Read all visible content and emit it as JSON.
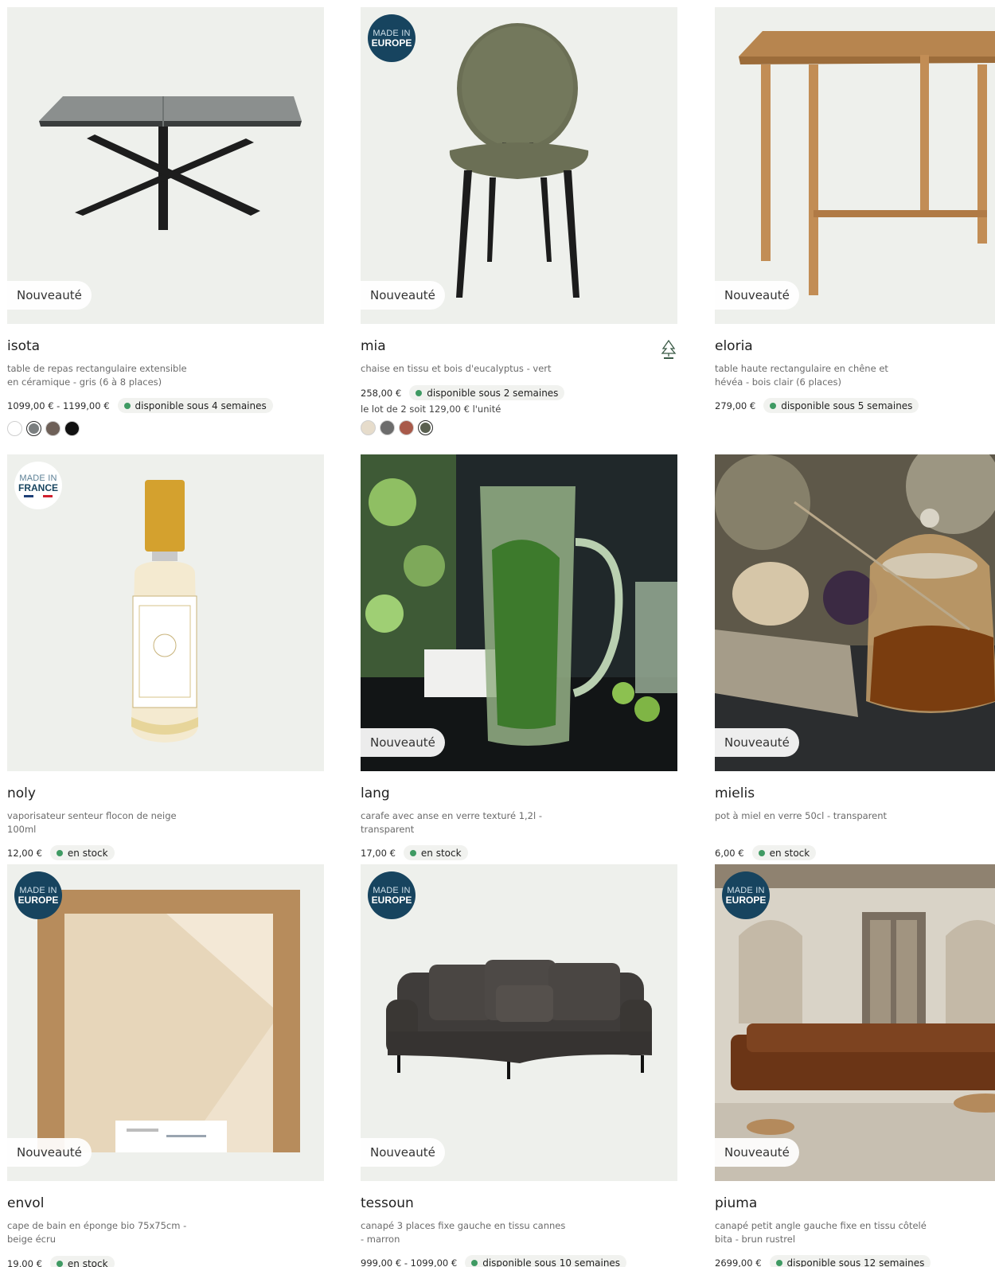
{
  "products": [
    {
      "name": "isota",
      "desc": "table de repas rectangulaire extensible en céramique - gris (6 à 8 places)",
      "price": "1099,00 € - 1199,00 €",
      "stock": "disponible sous 4 semaines",
      "badge": "Nouveauté",
      "swatches": [
        "#ffffff",
        "#7b7f80",
        "#6e6058",
        "#111111"
      ]
    },
    {
      "name": "mia",
      "desc": "chaise en tissu et bois d'eucalyptus - vert",
      "price": "258,00 €",
      "stock": "disponible sous 2 semaines",
      "lot": "le lot de 2 soit 129,00 € l'unité",
      "badge": "Nouveauté",
      "origin_top": "MADE IN",
      "origin_bottom": "EUROPE",
      "swatches": [
        "#e6dccb",
        "#6c6c6c",
        "#a85a4a",
        "#5a6050"
      ]
    },
    {
      "name": "eloria",
      "desc": "table haute rectangulaire en chêne et hévéa - bois clair (6 places)",
      "price": "279,00 €",
      "stock": "disponible sous 5 semaines",
      "badge": "Nouveauté"
    },
    {
      "name": "noly",
      "desc": "vaporisateur senteur flocon de neige 100ml",
      "price": "12,00 €",
      "stock": "en stock",
      "origin_top": "MADE IN",
      "origin_bottom": "FRANCE"
    },
    {
      "name": "lang",
      "desc": "carafe avec anse en verre texturé 1,2l - transparent",
      "price": "17,00 €",
      "stock": "en stock",
      "badge": "Nouveauté"
    },
    {
      "name": "mielis",
      "desc": "pot à miel en verre 50cl - transparent",
      "price": "6,00 €",
      "stock": "en stock",
      "badge": "Nouveauté"
    },
    {
      "name": "envol",
      "desc": "cape de bain en éponge bio 75x75cm - beige écru",
      "price": "19,00 €",
      "stock": "en stock",
      "badge": "Nouveauté",
      "origin_top": "MADE IN",
      "origin_bottom": "EUROPE"
    },
    {
      "name": "tessoun",
      "desc": "canapé 3 places fixe gauche en tissu cannes - marron",
      "price": "999,00 € - 1099,00 €",
      "stock": "disponible sous 10 semaines",
      "badge": "Nouveauté",
      "origin_top": "MADE IN",
      "origin_bottom": "EUROPE"
    },
    {
      "name": "piuma",
      "desc": "canapé petit angle gauche fixe en tissu côtelé bita - brun rustrel",
      "price": "2699,00 €",
      "stock": "disponible sous 12 semaines",
      "badge": "Nouveauté",
      "origin_top": "MADE IN",
      "origin_bottom": "EUROPE"
    }
  ],
  "icons": {
    "fsc": "fsc-tree-icon",
    "stock": "green-dot-icon"
  },
  "colors": {
    "stock_dot": "#3f9a63",
    "origin_badge": "#17445f",
    "media_bg": "#eef0ec"
  }
}
